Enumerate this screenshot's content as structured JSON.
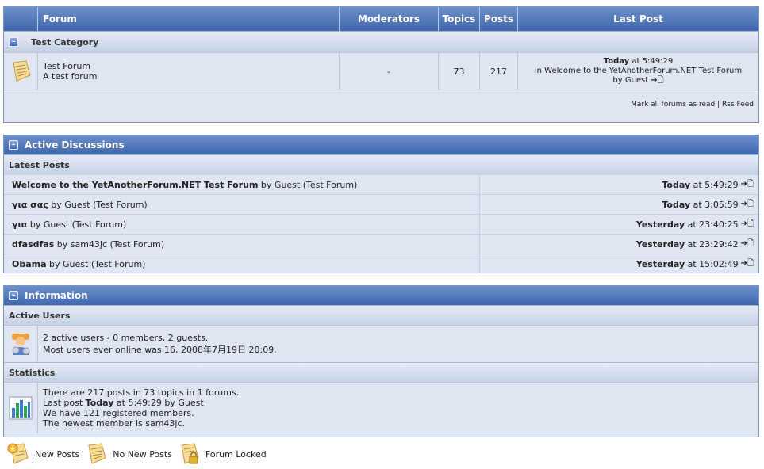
{
  "forum_table": {
    "headers": {
      "forum": "Forum",
      "moderators": "Moderators",
      "topics": "Topics",
      "posts": "Posts",
      "last_post": "Last Post"
    },
    "category": {
      "title": "Test Category",
      "toggle": "–"
    },
    "forum": {
      "name": "Test Forum",
      "description": "A test forum",
      "moderators": "-",
      "topics": "73",
      "posts": "217",
      "last_post_day": "Today",
      "last_post_time": " at 5:49:29",
      "last_post_in": "in Welcome to the YetAnotherForum.NET Test Forum",
      "last_post_by": "by Guest"
    },
    "footer": {
      "mark_read": "Mark all forums as read",
      "separator": " | ",
      "rss": "Rss Feed"
    }
  },
  "active_discussions": {
    "title": "Active Discussions",
    "subheader": "Latest Posts",
    "posts": [
      {
        "topic": "Welcome to the YetAnotherForum.NET Test Forum",
        "by": " by Guest (Test Forum)",
        "day": "Today",
        "time": " at 5:49:29"
      },
      {
        "topic": "για σας",
        "by": " by Guest (Test Forum)",
        "day": "Today",
        "time": " at 3:05:59"
      },
      {
        "topic": "για",
        "by": " by Guest (Test Forum)",
        "day": "Yesterday",
        "time": " at 23:40:25"
      },
      {
        "topic": "dfasdfas",
        "by": " by sam43jc (Test Forum)",
        "day": "Yesterday",
        "time": " at 23:29:42"
      },
      {
        "topic": "Obama",
        "by": " by Guest (Test Forum)",
        "day": "Yesterday",
        "time": " at 15:02:49"
      }
    ]
  },
  "information": {
    "title": "Information",
    "active_users": {
      "subheader": "Active Users",
      "line1": "2 active users - 0 members, 2 guests.",
      "line2": "Most users ever online was 16, 2008年7月19日 20:09."
    },
    "statistics": {
      "subheader": "Statistics",
      "line1": "There are 217 posts in 73 topics in 1 forums.",
      "line2_pre": "Last post ",
      "line2_day": "Today",
      "line2_post": " at 5:49:29 by Guest.",
      "line3": "We have 121 registered members.",
      "line4": "The newest member is sam43jc."
    }
  },
  "legend": {
    "new_posts": "New Posts",
    "no_new_posts": "No New Posts",
    "forum_locked": "Forum Locked"
  },
  "arrow_glyph": "➔🗋",
  "colors": {
    "header_top": "#6d8fcb",
    "header_bottom": "#3f67ad",
    "row_bg": "#dfe6f1",
    "border": "#7b96c0"
  }
}
